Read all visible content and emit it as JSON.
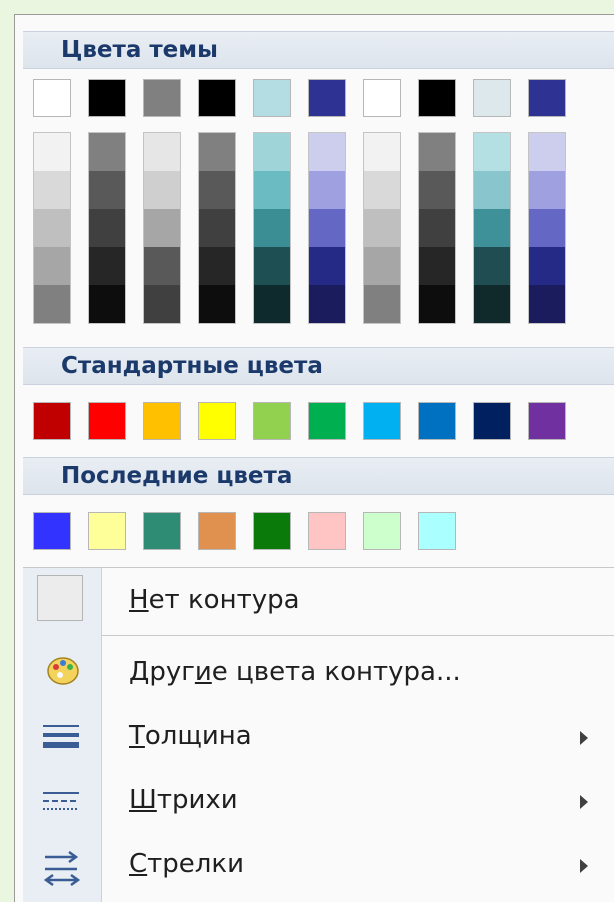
{
  "sections": {
    "theme": "Цвета темы",
    "standard": "Стандартные цвета",
    "recent": "Последние цвета"
  },
  "theme_top_row": [
    "#ffffff",
    "#000000",
    "#808080",
    "#000000",
    "#b3dde2",
    "#2e3292",
    "#ffffff",
    "#000000",
    "#dde8ec",
    "#2e3292"
  ],
  "theme_shades": [
    [
      "#f2f2f2",
      "#d9d9d9",
      "#bfbfbf",
      "#a6a6a6",
      "#808080"
    ],
    [
      "#808080",
      "#595959",
      "#404040",
      "#262626",
      "#0d0d0d"
    ],
    [
      "#e6e6e6",
      "#cfcfcf",
      "#a6a6a6",
      "#595959",
      "#404040"
    ],
    [
      "#808080",
      "#595959",
      "#404040",
      "#262626",
      "#0d0d0d"
    ],
    [
      "#9fd4d8",
      "#6bbcc2",
      "#3b8e94",
      "#1e4f53",
      "#0f2a2c"
    ],
    [
      "#cdcdee",
      "#9fa0e0",
      "#6567c4",
      "#252a86",
      "#1a1c5e"
    ],
    [
      "#f2f2f2",
      "#d9d9d9",
      "#bfbfbf",
      "#a6a6a6",
      "#808080"
    ],
    [
      "#808080",
      "#595959",
      "#404040",
      "#262626",
      "#0d0d0d"
    ],
    [
      "#b4dfe3",
      "#89c5cc",
      "#3e9199",
      "#1f4d51",
      "#10292b"
    ],
    [
      "#cdcdee",
      "#9fa0e0",
      "#6567c4",
      "#252a86",
      "#1a1c5e"
    ]
  ],
  "standard_colors": [
    "#c00000",
    "#ff0000",
    "#ffc000",
    "#ffff00",
    "#92d050",
    "#00b050",
    "#00b0f0",
    "#0070c0",
    "#002060",
    "#7030a0"
  ],
  "recent_colors": [
    "#3333ff",
    "#ffff99",
    "#2e8b74",
    "#e0914f",
    "#0a7a0a",
    "#ffc4c4",
    "#ccffcc",
    "#aaffff"
  ],
  "menu": {
    "no_outline": "Нет контура",
    "more_colors": "Другие цвета контура...",
    "weight": "Толщина",
    "dashes": "Штрихи",
    "arrows": "Стрелки"
  },
  "icons": {
    "no_outline": "empty-swatch-icon",
    "more_colors": "palette-icon",
    "weight": "line-weight-icon",
    "dashes": "dashes-icon",
    "arrows": "arrows-icon"
  }
}
